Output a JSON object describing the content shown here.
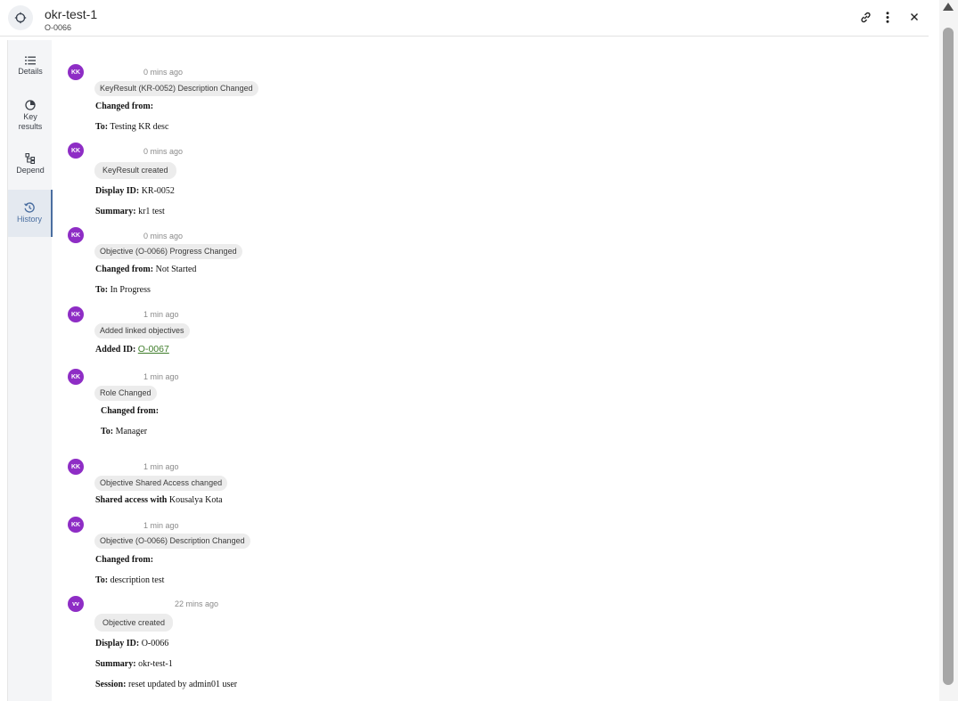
{
  "header": {
    "title": "okr-test-1",
    "subtitle": "O-0066",
    "icons": {
      "object": "target-icon",
      "link": "link-icon",
      "more": "more-vertical-icon",
      "close": "close-icon"
    }
  },
  "sidebar": {
    "items": [
      {
        "label_1": "Details",
        "label_2": "",
        "icon": "list-icon"
      },
      {
        "label_1": "Key",
        "label_2": "results",
        "icon": "pie-chart-icon"
      },
      {
        "label_1": "Depend",
        "label_2": "",
        "icon": "dependency-icon"
      },
      {
        "label_1": "History",
        "label_2": "",
        "icon": "history-icon",
        "active": true
      }
    ]
  },
  "history": [
    {
      "avatar": "KK",
      "time": "0 mins ago",
      "tag": "KeyResult (KR-0052) Description Changed",
      "lines": [
        {
          "label": "Changed from:",
          "value": ""
        },
        {
          "label": "To:",
          "value": "Testing KR desc"
        }
      ]
    },
    {
      "avatar": "KK",
      "time": "0 mins ago",
      "tag": "KeyResult created",
      "lines": [
        {
          "label": "Display ID:",
          "value": "KR-0052"
        },
        {
          "label": "Summary:",
          "value": "kr1 test"
        }
      ]
    },
    {
      "avatar": "KK",
      "time": "0 mins ago",
      "tag": "Objective (O-0066) Progress Changed",
      "lines": [
        {
          "label": "Changed from:",
          "value": "Not Started"
        },
        {
          "label": "To:",
          "value": "In Progress"
        }
      ]
    },
    {
      "avatar": "KK",
      "time": "1 min ago",
      "tag": "Added linked objectives",
      "lines": [
        {
          "label": "Added ID:",
          "value": "O-0067"
        }
      ]
    },
    {
      "avatar": "KK",
      "time": "1 min ago",
      "tag": "Role Changed",
      "lines": [
        {
          "label": "Changed from:",
          "value": ""
        },
        {
          "label": "To:",
          "value": "Manager"
        }
      ]
    },
    {
      "avatar": "KK",
      "time": "1 min ago",
      "tag": "Objective Shared Access changed",
      "lines": [
        {
          "label": "Shared access with",
          "value": "Kousalya Kota"
        }
      ]
    },
    {
      "avatar": "KK",
      "time": "1 min ago",
      "tag": "Objective (O-0066) Description Changed",
      "lines": [
        {
          "label": "Changed from:",
          "value": ""
        },
        {
          "label": "To:",
          "value": "description test"
        }
      ]
    },
    {
      "avatar": "vv",
      "time": "22 mins ago",
      "tag": "Objective created",
      "lines": [
        {
          "label": "Display ID:",
          "value": "O-0066"
        },
        {
          "label": "Summary:",
          "value": "okr-test-1"
        },
        {
          "label": "Session:",
          "value": "reset updated by admin01 user"
        }
      ]
    }
  ]
}
